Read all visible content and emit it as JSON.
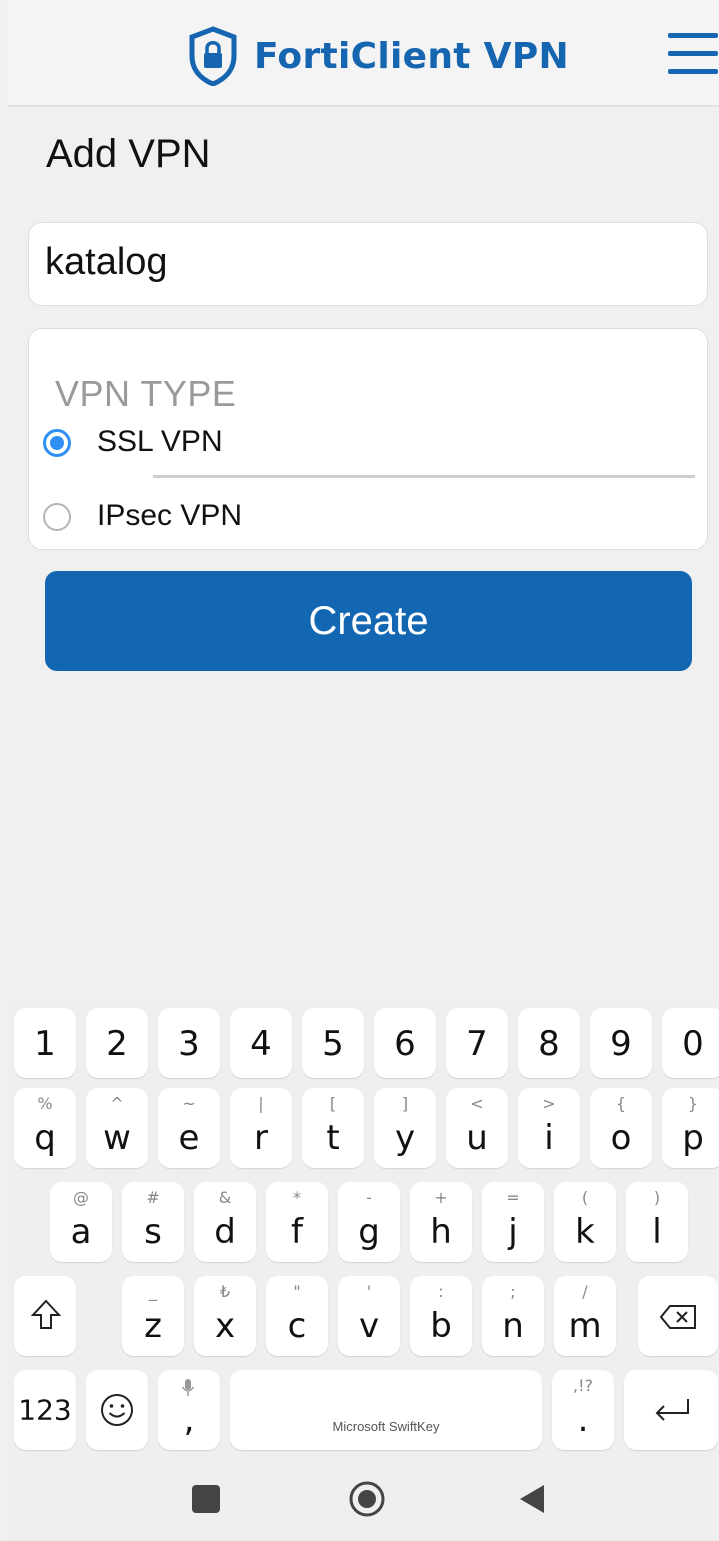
{
  "header": {
    "title": "FortiClient VPN"
  },
  "page": {
    "title": "Add VPN"
  },
  "name_field": {
    "value": "katalog",
    "placeholder": ""
  },
  "vpn_type": {
    "label": "VPN TYPE",
    "options": [
      {
        "label": "SSL VPN",
        "selected": true
      },
      {
        "label": "IPsec VPN",
        "selected": false
      }
    ]
  },
  "create_button": {
    "label": "Create"
  },
  "keyboard": {
    "number_row": [
      "1",
      "2",
      "3",
      "4",
      "5",
      "6",
      "7",
      "8",
      "9",
      "0"
    ],
    "row1": [
      {
        "main": "q",
        "sub": "%"
      },
      {
        "main": "w",
        "sub": "^"
      },
      {
        "main": "e",
        "sub": "~"
      },
      {
        "main": "r",
        "sub": "|"
      },
      {
        "main": "t",
        "sub": "["
      },
      {
        "main": "y",
        "sub": "]"
      },
      {
        "main": "u",
        "sub": "<"
      },
      {
        "main": "i",
        "sub": ">"
      },
      {
        "main": "o",
        "sub": "{"
      },
      {
        "main": "p",
        "sub": "}"
      }
    ],
    "row2": [
      {
        "main": "a",
        "sub": "@"
      },
      {
        "main": "s",
        "sub": "#"
      },
      {
        "main": "d",
        "sub": "&"
      },
      {
        "main": "f",
        "sub": "*"
      },
      {
        "main": "g",
        "sub": "-"
      },
      {
        "main": "h",
        "sub": "+"
      },
      {
        "main": "j",
        "sub": "="
      },
      {
        "main": "k",
        "sub": "("
      },
      {
        "main": "l",
        "sub": ")"
      }
    ],
    "row3": [
      {
        "main": "z",
        "sub": "_"
      },
      {
        "main": "x",
        "sub": "₺"
      },
      {
        "main": "c",
        "sub": "\""
      },
      {
        "main": "v",
        "sub": "'"
      },
      {
        "main": "b",
        "sub": ":"
      },
      {
        "main": "n",
        "sub": ";"
      },
      {
        "main": "m",
        "sub": "/"
      }
    ],
    "numbers_key": "123",
    "comma_key": ",",
    "period_key": ".",
    "period_sub": ",!?",
    "space_brand": "Microsoft SwiftKey"
  },
  "accent_color": "#1366b2",
  "radio_color": "#2f8ff2"
}
